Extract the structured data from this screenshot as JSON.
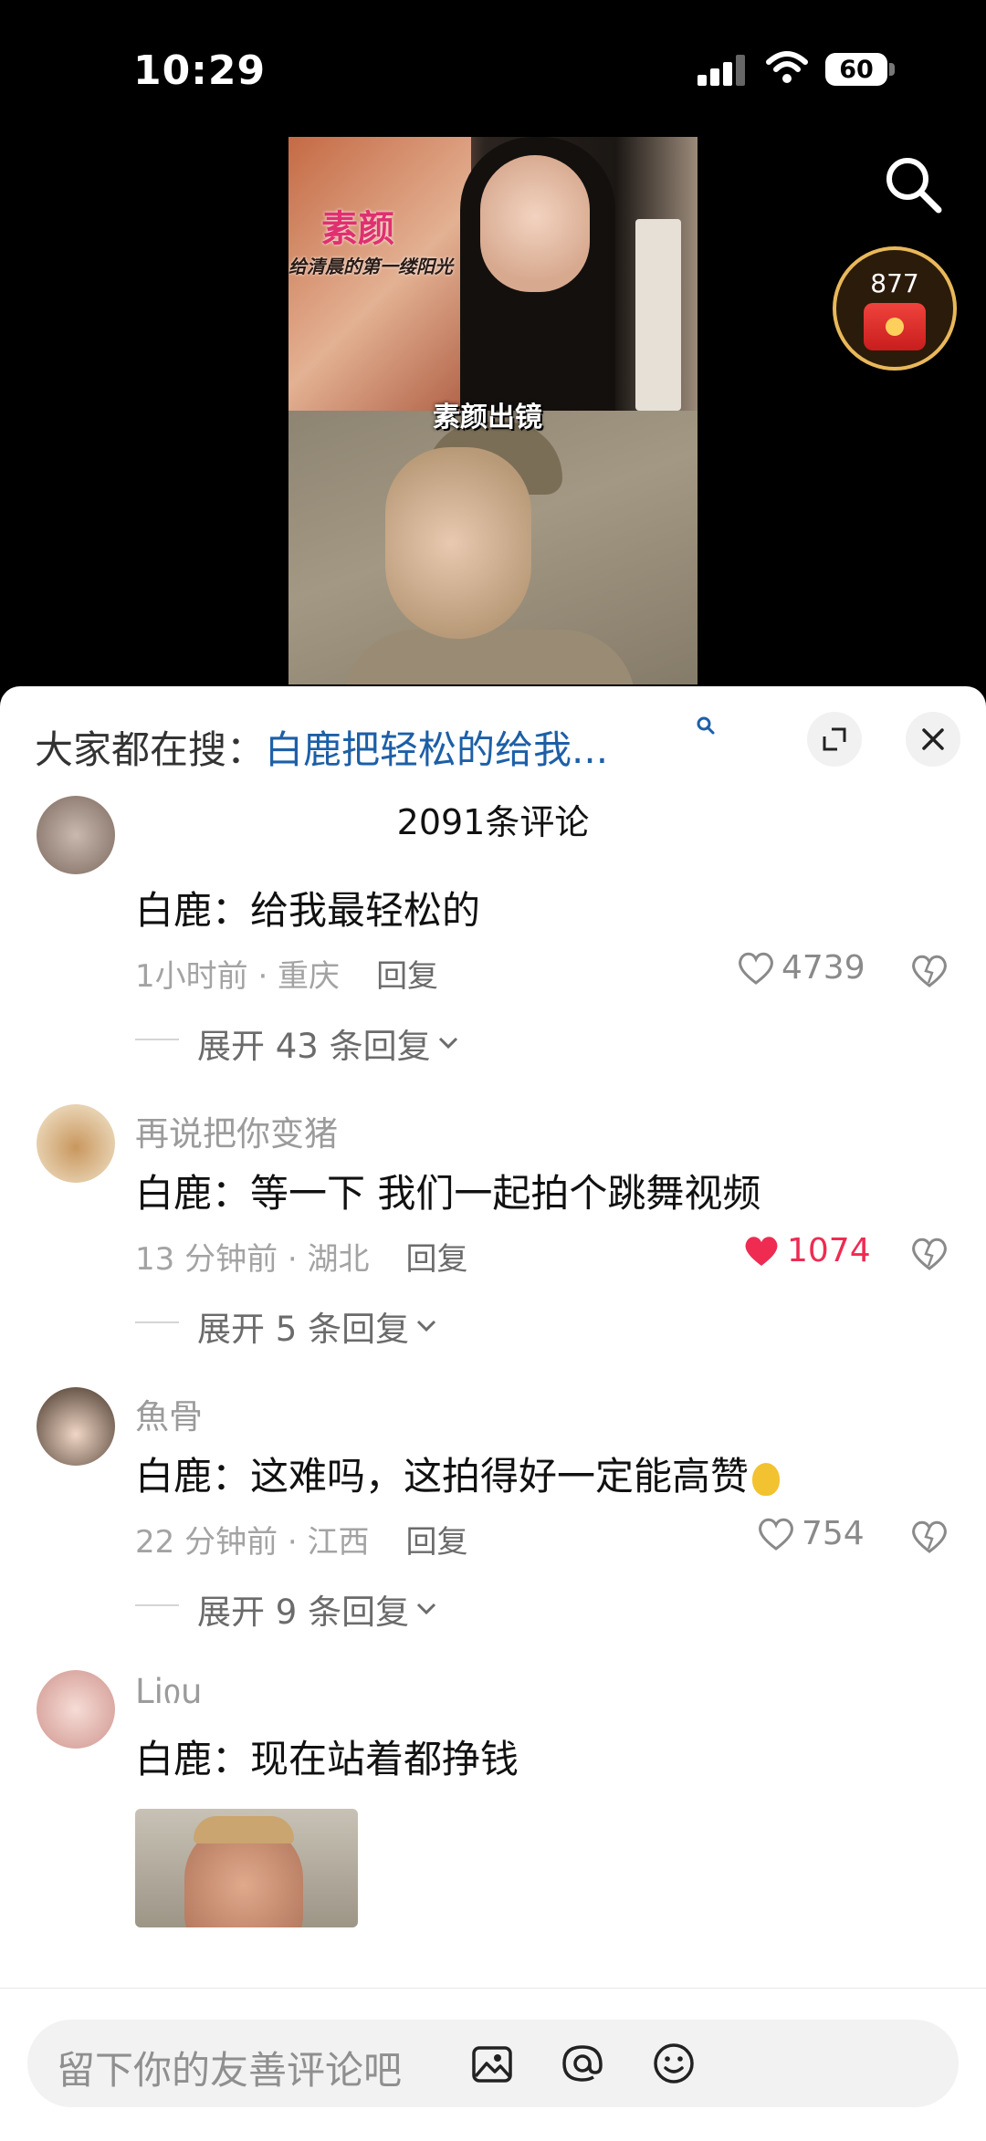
{
  "status_bar": {
    "time": "10:29",
    "battery": "60"
  },
  "video": {
    "overlay_title": "素颜",
    "overlay_subtitle": "给清晨的第一缕阳光",
    "overlay_caption": "素颜出镜"
  },
  "redpacket": {
    "count": "877"
  },
  "sheet": {
    "trend_label": "大家都在搜：",
    "trend_query": "白鹿把轻松的给我...",
    "comment_count": "2091条评论"
  },
  "comments": [
    {
      "user": "",
      "text": "白鹿：给我最轻松的",
      "time_location": "1小时前 · 重庆",
      "reply": "回复",
      "likes": "4739",
      "liked": false,
      "expand": "展开 43 条回复"
    },
    {
      "user": "再说把你变猪",
      "text": "白鹿：等一下 我们一起拍个跳舞视频",
      "time_location": "13 分钟前 · 湖北",
      "reply": "回复",
      "likes": "1074",
      "liked": true,
      "expand": "展开 5 条回复"
    },
    {
      "user": "魚骨",
      "text": "白鹿：这难吗，这拍得好一定能高赞",
      "time_location": "22 分钟前 · 江西",
      "reply": "回复",
      "likes": "754",
      "liked": false,
      "expand": "展开 9 条回复"
    },
    {
      "user": "Liიu",
      "text": "白鹿：现在站着都挣钱"
    }
  ],
  "input": {
    "placeholder": "留下你的友善评论吧"
  },
  "colors": {
    "accent_blue": "#1d5fa7",
    "like_red": "#ef2b52"
  }
}
